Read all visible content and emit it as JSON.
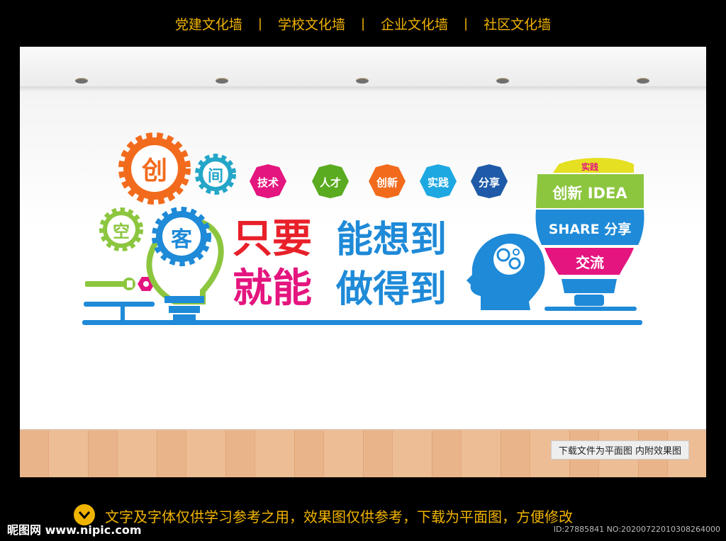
{
  "nav": {
    "items": [
      "党建文化墙",
      "学校文化墙",
      "企业文化墙",
      "社区文化墙"
    ],
    "separator": "|"
  },
  "artwork": {
    "gears": [
      "创",
      "间",
      "空",
      "客"
    ],
    "hexagons": [
      {
        "label": "技术",
        "color": "#e4157f"
      },
      {
        "label": "人才",
        "color": "#5aab1f"
      },
      {
        "label": "创新",
        "color": "#f26b1d"
      },
      {
        "label": "实践",
        "color": "#1da8e1"
      },
      {
        "label": "分享",
        "color": "#1e5aa8"
      }
    ],
    "slogan": {
      "line1_a": "只要",
      "line1_b": "能想到",
      "line2_a": "就能",
      "line2_b": "做得到"
    },
    "bulb_bands": [
      "实践",
      "创新 IDEA",
      "SHARE 分享",
      "交流"
    ],
    "colors": {
      "orange": "#f26b1d",
      "teal": "#23a6c8",
      "green": "#8cc63f",
      "blue": "#1e8ad8",
      "red": "#e8202a",
      "magenta": "#e4157f",
      "yellow": "#e5e021",
      "purple": "#6b3fa0"
    },
    "icons": [
      "gear-icon",
      "wrench-icon",
      "nut-icon",
      "head-brain-icon",
      "lightbulb-icon"
    ]
  },
  "scene": {
    "caption": "下载文件为平面图  内附效果图"
  },
  "footer": {
    "notice": "文字及字体仅供学习参考之用，效果图仅供参考，下载为平面图，方便修改",
    "logo": "昵图网 www.nipic.com",
    "image_id": "ID:27885841 NO:20200722010308264000"
  }
}
